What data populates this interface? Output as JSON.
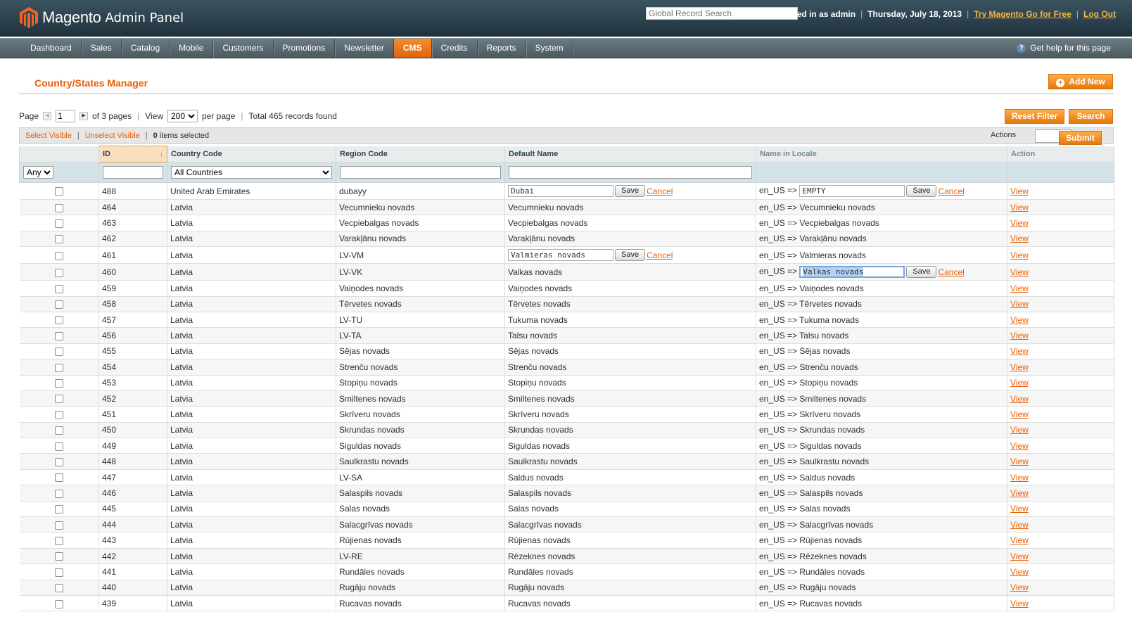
{
  "header": {
    "logo_text": "Magento",
    "logo_sub": "Admin Panel",
    "search_placeholder": "Global Record Search",
    "logged_in": "Logged in as admin",
    "date": "Thursday, July 18, 2013",
    "try_link": "Try Magento Go for Free",
    "logout": "Log Out"
  },
  "nav": {
    "items": [
      "Dashboard",
      "Sales",
      "Catalog",
      "Mobile",
      "Customers",
      "Promotions",
      "Newsletter",
      "CMS",
      "Credits",
      "Reports",
      "System"
    ],
    "active": "CMS",
    "help": "Get help for this page"
  },
  "page": {
    "title": "Country/States Manager",
    "add_new": "Add New",
    "reset_filter": "Reset Filter",
    "search": "Search",
    "submit": "Submit"
  },
  "pager": {
    "page_label": "Page",
    "page_value": "1",
    "of_pages": "of 3 pages",
    "view_label": "View",
    "view_value": "200",
    "per_page": "per page",
    "total": "Total 465 records found"
  },
  "massaction": {
    "select_visible": "Select Visible",
    "unselect_visible": "Unselect Visible",
    "selected_count": "0",
    "selected_text": "items selected",
    "actions_label": "Actions"
  },
  "grid": {
    "columns": [
      "ID",
      "Country Code",
      "Region Code",
      "Default Name",
      "Name in Locale",
      "Action"
    ],
    "filter": {
      "any": "Any",
      "country": "All Countries"
    },
    "locale_prefix": "en_US =>",
    "save_label": "Save",
    "cancel_label": "Cancel",
    "view_label": "View",
    "rows": [
      {
        "id": "488",
        "country": "United Arab Emirates",
        "code": "dubayy",
        "name": "Dubai",
        "locale": "EMPTY",
        "edit_name": true,
        "edit_locale": true
      },
      {
        "id": "464",
        "country": "Latvia",
        "code": "Vecumnieku novads",
        "name": "Vecumnieku novads",
        "locale": "Vecumnieku novads"
      },
      {
        "id": "463",
        "country": "Latvia",
        "code": "Vecpiebalgas novads",
        "name": "Vecpiebalgas novads",
        "locale": "Vecpiebalgas novads"
      },
      {
        "id": "462",
        "country": "Latvia",
        "code": "Varakļānu novads",
        "name": "Varakļānu novads",
        "locale": "Varakļānu novads"
      },
      {
        "id": "461",
        "country": "Latvia",
        "code": "LV-VM",
        "name": "Valmieras novads",
        "locale": "Valmieras novads",
        "edit_name": true
      },
      {
        "id": "460",
        "country": "Latvia",
        "code": "LV-VK",
        "name": "Valkas novads",
        "locale": "Valkas novads",
        "edit_locale": true,
        "focus": true
      },
      {
        "id": "459",
        "country": "Latvia",
        "code": "Vaiņodes novads",
        "name": "Vaiņodes novads",
        "locale": "Vaiņodes novads"
      },
      {
        "id": "458",
        "country": "Latvia",
        "code": "Tērvetes novads",
        "name": "Tērvetes novads",
        "locale": "Tērvetes novads"
      },
      {
        "id": "457",
        "country": "Latvia",
        "code": "LV-TU",
        "name": "Tukuma novads",
        "locale": "Tukuma novads"
      },
      {
        "id": "456",
        "country": "Latvia",
        "code": "LV-TA",
        "name": "Talsu novads",
        "locale": "Talsu novads"
      },
      {
        "id": "455",
        "country": "Latvia",
        "code": "Sējas novads",
        "name": "Sējas novads",
        "locale": "Sējas novads"
      },
      {
        "id": "454",
        "country": "Latvia",
        "code": "Strenču novads",
        "name": "Strenču novads",
        "locale": "Strenču novads"
      },
      {
        "id": "453",
        "country": "Latvia",
        "code": "Stopiņu novads",
        "name": "Stopiņu novads",
        "locale": "Stopiņu novads"
      },
      {
        "id": "452",
        "country": "Latvia",
        "code": "Smiltenes novads",
        "name": "Smiltenes novads",
        "locale": "Smiltenes novads"
      },
      {
        "id": "451",
        "country": "Latvia",
        "code": "Skrīveru novads",
        "name": "Skrīveru novads",
        "locale": "Skrīveru novads"
      },
      {
        "id": "450",
        "country": "Latvia",
        "code": "Skrundas novads",
        "name": "Skrundas novads",
        "locale": "Skrundas novads"
      },
      {
        "id": "449",
        "country": "Latvia",
        "code": "Siguldas novads",
        "name": "Siguldas novads",
        "locale": "Siguldas novads"
      },
      {
        "id": "448",
        "country": "Latvia",
        "code": "Saulkrastu novads",
        "name": "Saulkrastu novads",
        "locale": "Saulkrastu novads"
      },
      {
        "id": "447",
        "country": "Latvia",
        "code": "LV-SA",
        "name": "Saldus novads",
        "locale": "Saldus novads"
      },
      {
        "id": "446",
        "country": "Latvia",
        "code": "Salaspils novads",
        "name": "Salaspils novads",
        "locale": "Salaspils novads"
      },
      {
        "id": "445",
        "country": "Latvia",
        "code": "Salas novads",
        "name": "Salas novads",
        "locale": "Salas novads"
      },
      {
        "id": "444",
        "country": "Latvia",
        "code": "Salacgrīvas novads",
        "name": "Salacgrīvas novads",
        "locale": "Salacgrīvas novads"
      },
      {
        "id": "443",
        "country": "Latvia",
        "code": "Rūjienas novads",
        "name": "Rūjienas novads",
        "locale": "Rūjienas novads"
      },
      {
        "id": "442",
        "country": "Latvia",
        "code": "LV-RE",
        "name": "Rēzeknes novads",
        "locale": "Rēzeknes novads"
      },
      {
        "id": "441",
        "country": "Latvia",
        "code": "Rundāles novads",
        "name": "Rundāles novads",
        "locale": "Rundāles novads"
      },
      {
        "id": "440",
        "country": "Latvia",
        "code": "Rugāju novads",
        "name": "Rugāju novads",
        "locale": "Rugāju novads"
      },
      {
        "id": "439",
        "country": "Latvia",
        "code": "Rucavas novads",
        "name": "Rucavas novads",
        "locale": "Rucavas novads"
      }
    ]
  },
  "colors": {
    "accent": "#eb5e00",
    "button": "#f18200",
    "header": "#2b3e47",
    "nav": "#5c6b72"
  }
}
